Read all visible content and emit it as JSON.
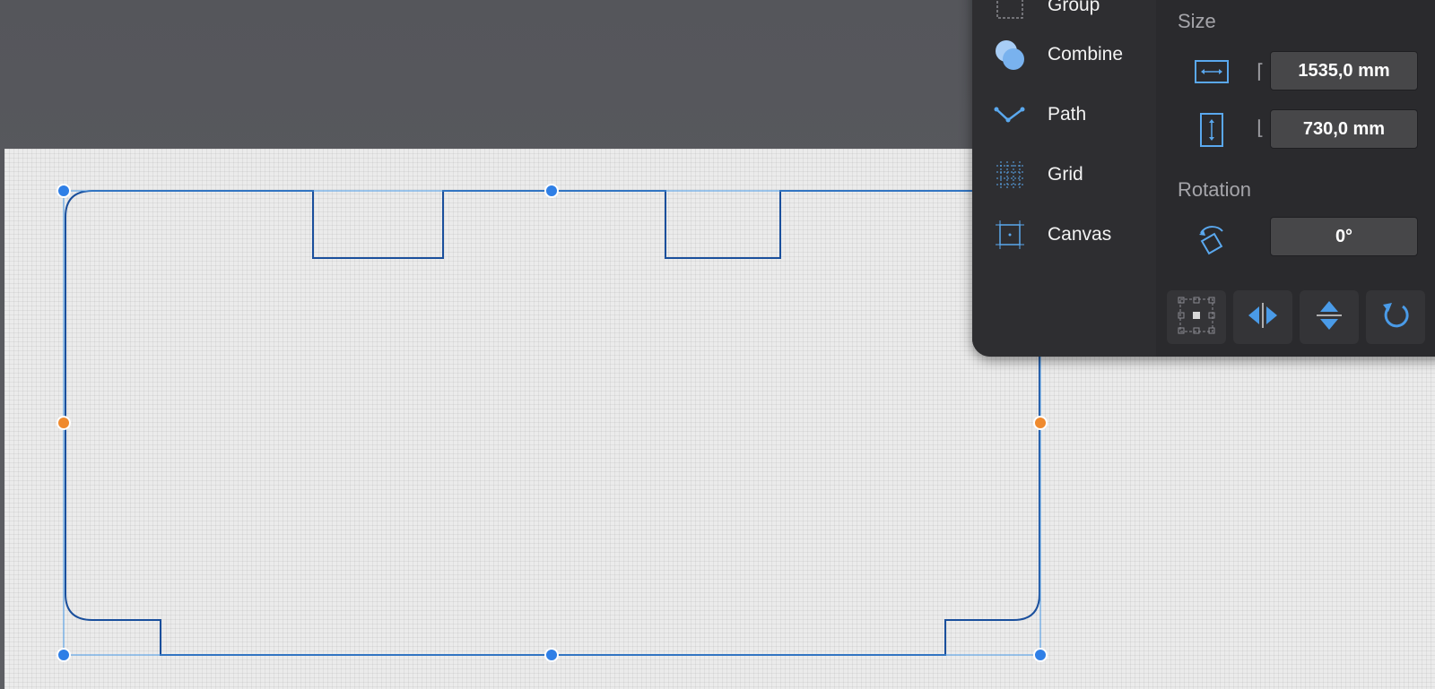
{
  "menu": {
    "items": [
      {
        "label": "Group",
        "icon": "group-icon"
      },
      {
        "label": "Combine",
        "icon": "combine-icon"
      },
      {
        "label": "Path",
        "icon": "path-icon"
      },
      {
        "label": "Grid",
        "icon": "grid-icon"
      },
      {
        "label": "Canvas",
        "icon": "canvas-icon"
      }
    ]
  },
  "properties": {
    "size_title": "Size",
    "width_value": "1535,0 mm",
    "height_value": "730,0 mm",
    "rotation_title": "Rotation",
    "rotation_value": "0°"
  },
  "toolbar": {
    "buttons": [
      "anchor-grid-icon",
      "flip-horizontal-icon",
      "flip-vertical-icon",
      "rotate-icon"
    ]
  },
  "colors": {
    "accent": "#4a9be8",
    "selection_handle": "#2f7fe6",
    "midpoint_handle": "#ef8a2e",
    "shape_stroke": "#1a4f9c",
    "panel_bg": "#2b2b2e"
  }
}
